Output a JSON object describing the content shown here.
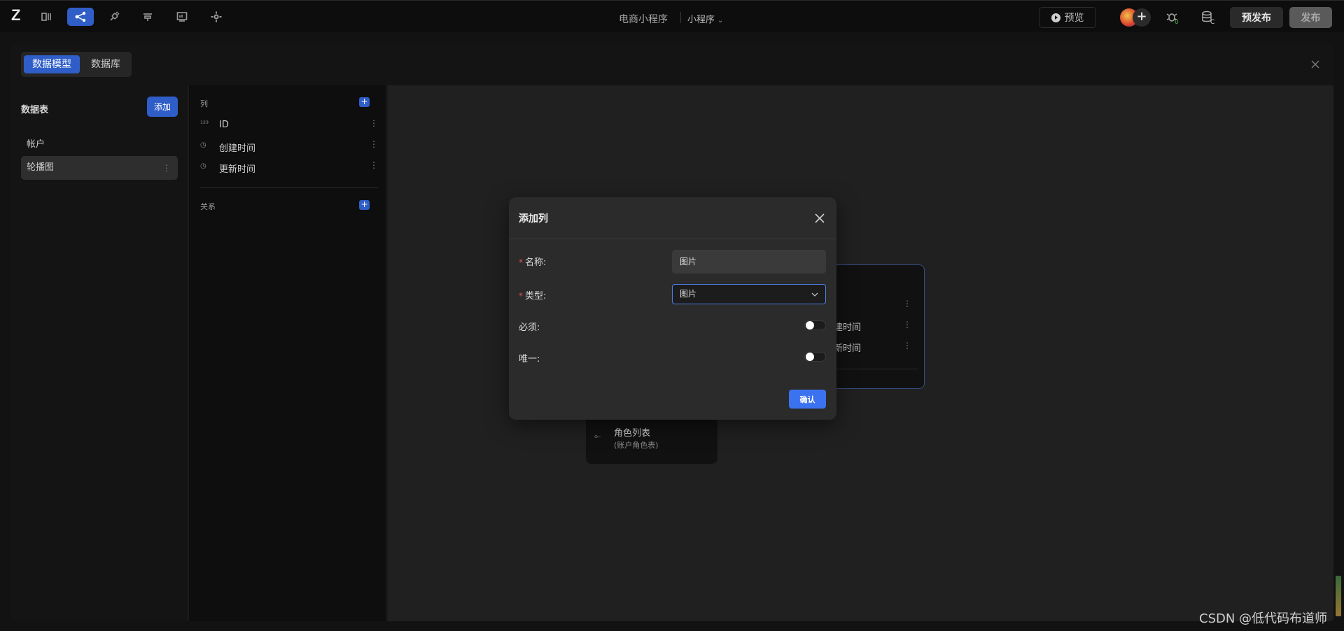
{
  "topbar": {
    "logo": "Z",
    "app_title": "电商小程序",
    "app_type": "小程序",
    "preview_label": "预览",
    "pre_publish_label": "预发布",
    "publish_label": "发布",
    "nav_icons": [
      "pages-icon",
      "data-model-icon",
      "api-icon",
      "component-icon",
      "chart-icon",
      "gear-icon"
    ]
  },
  "panel": {
    "tabs": [
      "数据模型",
      "数据库"
    ],
    "active_tab": "数据模型"
  },
  "tables": {
    "title": "数据表",
    "add_label": "添加",
    "items": [
      "帐户",
      "轮播图"
    ],
    "selected": "轮播图"
  },
  "columns": {
    "title": "列",
    "items": [
      {
        "icon": "number-icon",
        "label": "ID"
      },
      {
        "icon": "clock-icon",
        "label": "创建时间"
      },
      {
        "icon": "clock-icon",
        "label": "更新时间"
      }
    ],
    "relations_title": "关系"
  },
  "canvas": {
    "card1": {
      "label": "角色列表",
      "sub": "(账户角色表)"
    },
    "card2": {
      "rows": [
        "建时间",
        "新时间"
      ]
    }
  },
  "modal": {
    "title": "添加列",
    "name_label": "名称:",
    "name_value": "图片",
    "type_label": "类型:",
    "type_value": "图片",
    "required_label": "必须:",
    "required_on": false,
    "unique_label": "唯一:",
    "unique_on": false,
    "confirm_label": "确认"
  },
  "watermark": "CSDN @低代码布道师",
  "colors": {
    "accent": "#2f5ec8",
    "confirm": "#3b72f0",
    "required_star": "#e05454"
  }
}
